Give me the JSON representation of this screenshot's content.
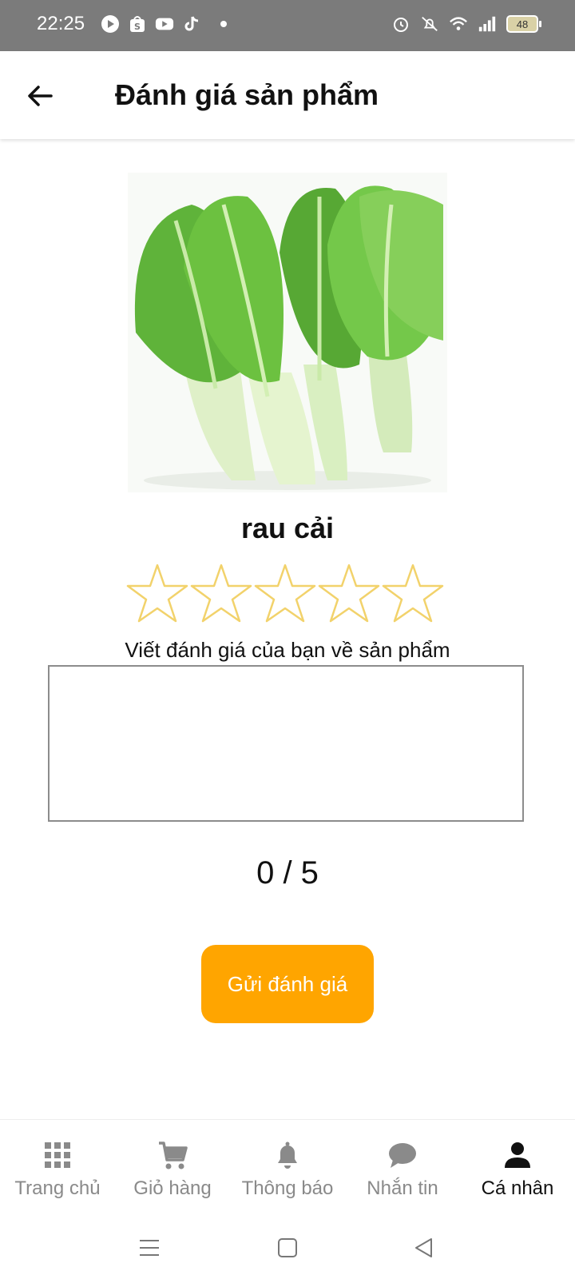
{
  "status_bar": {
    "time": "22:25",
    "battery": "48",
    "left_icons": [
      "play-icon",
      "shopee-bag-icon",
      "youtube-icon",
      "tiktok-icon",
      "dot-icon"
    ],
    "right_icons": [
      "alarm-icon",
      "mute-icon",
      "wifi-icon",
      "signal-icon",
      "battery-icon"
    ]
  },
  "header": {
    "title": "Đánh giá sản phẩm",
    "back_icon": "arrow-left-icon"
  },
  "product": {
    "name": "rau cải",
    "image": "bok-choy-photo"
  },
  "rating": {
    "max_stars": 5,
    "selected": 0,
    "star_color": "#f2d26b",
    "count_text": "0 / 5"
  },
  "review": {
    "label": "Viết đánh giá của bạn về sản phẩm",
    "value": "",
    "placeholder": ""
  },
  "submit": {
    "label": "Gửi đánh giá",
    "color": "#ffa500"
  },
  "bottom_nav": {
    "items": [
      {
        "label": "Trang chủ",
        "icon": "grid-icon",
        "active": false
      },
      {
        "label": "Giỏ hàng",
        "icon": "cart-icon",
        "active": false
      },
      {
        "label": "Thông báo",
        "icon": "bell-icon",
        "active": false
      },
      {
        "label": "Nhắn tin",
        "icon": "chat-icon",
        "active": false
      },
      {
        "label": "Cá nhân",
        "icon": "person-icon",
        "active": true
      }
    ]
  },
  "system_nav": [
    "menu-icon",
    "home-square-icon",
    "back-triangle-icon"
  ]
}
